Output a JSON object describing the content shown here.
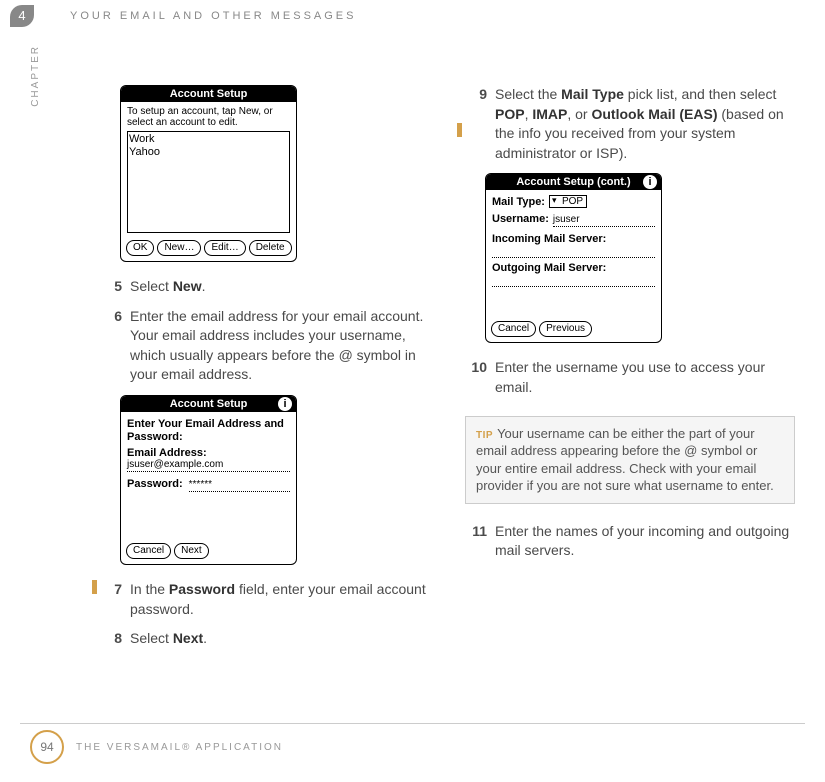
{
  "chapter": {
    "number": "4",
    "label": "CHAPTER",
    "title": "YOUR EMAIL AND OTHER MESSAGES"
  },
  "footer": {
    "page": "94",
    "title": "THE VERSAMAIL® APPLICATION"
  },
  "palm1": {
    "title": "Account Setup",
    "instruct": "To setup an account, tap New, or select an account to edit.",
    "listItems": [
      "Work",
      "Yahoo"
    ],
    "btn_ok": "OK",
    "btn_new": "New…",
    "btn_edit": "Edit…",
    "btn_delete": "Delete"
  },
  "palm2": {
    "title": "Account Setup",
    "heading": "Enter Your Email Address and Password:",
    "label_email": "Email Address:",
    "value_email": "jsuser@example.com",
    "label_password": "Password:",
    "value_password": "******",
    "btn_cancel": "Cancel",
    "btn_next": "Next"
  },
  "palm3": {
    "title": "Account Setup (cont.)",
    "label_mailtype": "Mail Type:",
    "value_mailtype": "POP",
    "label_username": "Username:",
    "value_username": "jsuser",
    "label_incoming": "Incoming Mail Server:",
    "label_outgoing": "Outgoing Mail Server:",
    "btn_cancel": "Cancel",
    "btn_previous": "Previous"
  },
  "steps": {
    "s5": {
      "num": "5",
      "a": "Select ",
      "b": "New",
      "c": "."
    },
    "s6": {
      "num": "6",
      "text": "Enter the email address for your email account. Your email address includes your username, which usually appears before the @ symbol in your email address."
    },
    "s7": {
      "num": "7",
      "a": "In the ",
      "b": "Password",
      "c": " field, enter your email account password."
    },
    "s8": {
      "num": "8",
      "a": " Select ",
      "b": "Next",
      "c": "."
    },
    "s9": {
      "num": "9",
      "a": "Select the ",
      "b": "Mail Type",
      "c": " pick list, and then select ",
      "d": "POP",
      "e": ", ",
      "f": "IMAP",
      "g": ", or ",
      "h": "Outlook Mail (EAS)",
      "i": " (based on the info you received from your system administrator or ISP)."
    },
    "s10": {
      "num": "10",
      "text": "Enter the username you use to access your email."
    },
    "s11": {
      "num": "11",
      "text": "Enter the names of your incoming and outgoing mail servers."
    }
  },
  "tip": {
    "label": "TIP",
    "text": "Your username can be either the part of your email address appearing before the @ symbol or your entire email address. Check with your email provider if you are not sure what username to enter."
  },
  "info_icon": "i"
}
